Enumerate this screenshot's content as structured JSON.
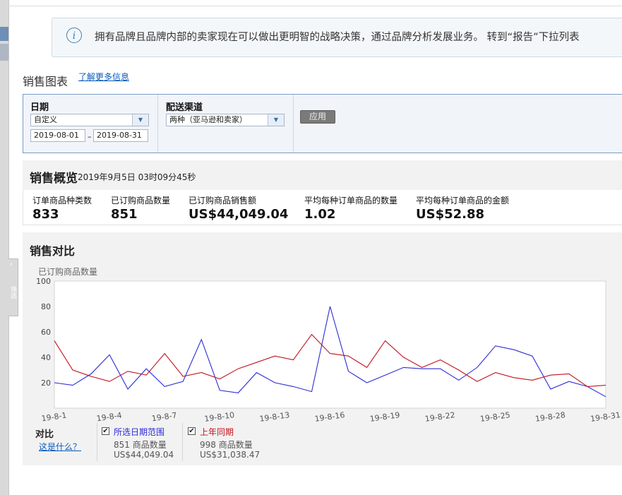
{
  "sidebar_tab": {
    "chevron": "‹",
    "text": "筛选"
  },
  "notice": {
    "icon": "info-icon",
    "message": "拥有品牌且品牌内部的卖家现在可以做出更明智的战略决策，通过品牌分析发展业务。 转到“报告”下拉列表"
  },
  "header": {
    "title": "销售图表",
    "learn_more": "了解更多信息"
  },
  "filters": {
    "date_label": "日期",
    "date_preset": "自定义",
    "date_from": "2019-08-01",
    "date_sep": "–",
    "date_to": "2019-08-31",
    "channel_label": "配送渠道",
    "channel_value": "两种（亚马逊和卖家）",
    "apply_label": "应用"
  },
  "overview": {
    "title": "销售概览",
    "timestamp": "2019年9月5日 03时09分45秒",
    "metrics": [
      {
        "label": "订单商品种类数",
        "value": "833"
      },
      {
        "label": "已订购商品数量",
        "value": "851"
      },
      {
        "label": "已订购商品销售额",
        "value": "US$44,049.04"
      },
      {
        "label": "平均每种订单商品的数量",
        "value": "1.02"
      },
      {
        "label": "平均每种订单商品的金额",
        "value": "US$52.88"
      }
    ]
  },
  "comparison": {
    "title": "销售对比",
    "legend_title": "对比",
    "legend_help": "这是什么？",
    "legend": [
      {
        "checked": "✔",
        "name": "所选日期范围",
        "count": "851 商品数量",
        "amount": "US$44,049.04",
        "color": "#2b2bd6"
      },
      {
        "checked": "✔",
        "name": "上年同期",
        "count": "998 商品数量",
        "amount": "US$31,038.47",
        "color": "#c1121f"
      }
    ]
  },
  "chart_data": {
    "type": "line",
    "ylabel": "已订购商品数量",
    "ylim": [
      0,
      100
    ],
    "yticks": [
      "20",
      "40",
      "60",
      "80",
      "100"
    ],
    "x": [
      "19-8-1",
      "19-8-2",
      "19-8-3",
      "19-8-4",
      "19-8-5",
      "19-8-6",
      "19-8-7",
      "19-8-8",
      "19-8-9",
      "19-8-10",
      "19-8-11",
      "19-8-12",
      "19-8-13",
      "19-8-14",
      "19-8-15",
      "19-8-16",
      "19-8-17",
      "19-8-18",
      "19-8-19",
      "19-8-20",
      "19-8-21",
      "19-8-22",
      "19-8-23",
      "19-8-24",
      "19-8-25",
      "19-8-26",
      "19-8-27",
      "19-8-28",
      "19-8-29",
      "19-8-30",
      "19-8-31"
    ],
    "xtick_labels": [
      "19-8-1",
      "19-8-4",
      "19-8-7",
      "19-8-10",
      "19-8-13",
      "19-8-16",
      "19-8-19",
      "19-8-22",
      "19-8-25",
      "19-8-28",
      "19-8-31"
    ],
    "grid": false,
    "series": [
      {
        "name": "所选日期范围",
        "color": "#2b2bd6",
        "values": [
          20,
          18,
          27,
          42,
          15,
          31,
          17,
          21,
          54,
          14,
          12,
          28,
          20,
          17,
          13,
          80,
          29,
          20,
          26,
          32,
          31,
          31,
          22,
          32,
          49,
          46,
          41,
          15,
          21,
          17,
          9
        ]
      },
      {
        "name": "上年同期",
        "color": "#c1121f",
        "values": [
          53,
          30,
          25,
          21,
          29,
          26,
          43,
          25,
          28,
          23,
          31,
          36,
          41,
          38,
          58,
          43,
          41,
          32,
          53,
          40,
          32,
          38,
          30,
          21,
          28,
          24,
          22,
          26,
          27,
          17,
          18
        ]
      }
    ]
  }
}
